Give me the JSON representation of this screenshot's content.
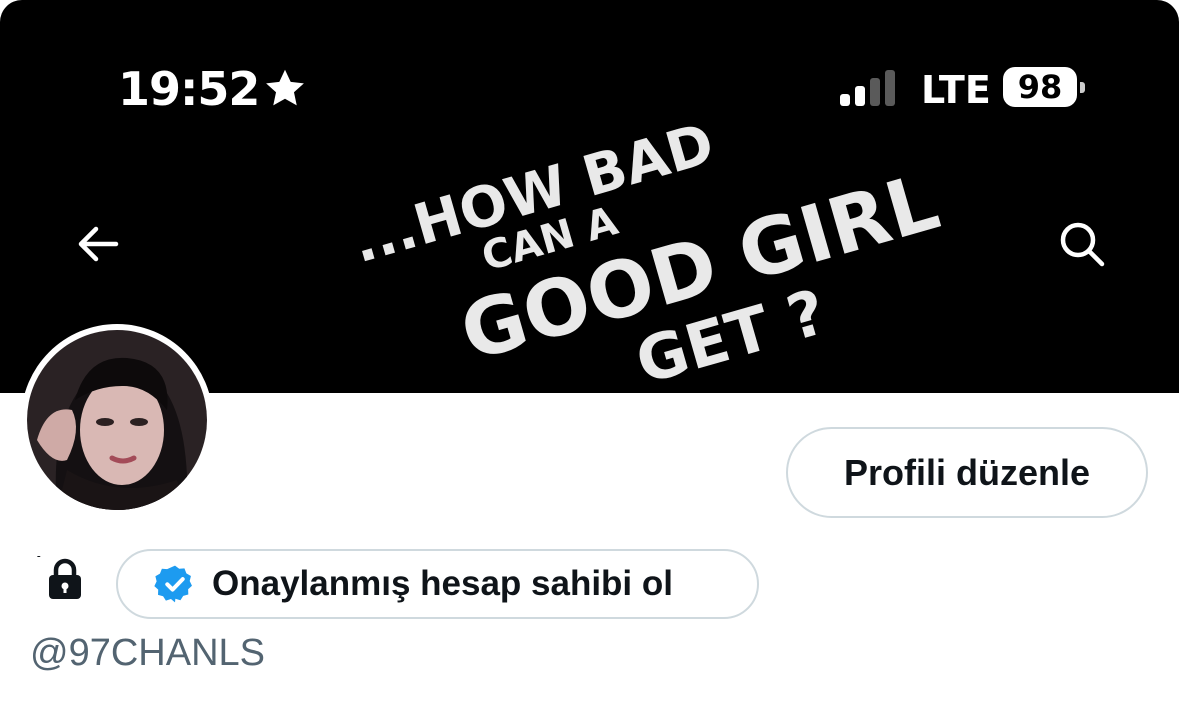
{
  "status_bar": {
    "time": "19:52",
    "star_icon": "star-icon",
    "network": "LTE",
    "battery_level": "98",
    "signal_bars_active": 2,
    "signal_bars_total": 4
  },
  "header": {
    "back_icon": "arrow-left-icon",
    "search_icon": "search-icon",
    "banner_text": [
      "...HOW BAD",
      "CAN A",
      "GOOD GIRL",
      "GET ?"
    ]
  },
  "profile": {
    "edit_button_label": "Profili düzenle",
    "name_mark": "´",
    "lock_icon": "lock-icon",
    "verify_button_label": "Onaylanmış hesap sahibi ol",
    "verified_icon": "verified-badge-icon",
    "handle": "@97CHANLS"
  },
  "colors": {
    "banner_bg": "#000000",
    "button_border": "#cfd9de",
    "verified_blue": "#1d9bf0",
    "handle_gray": "#536471",
    "text_primary": "#0f1419"
  }
}
